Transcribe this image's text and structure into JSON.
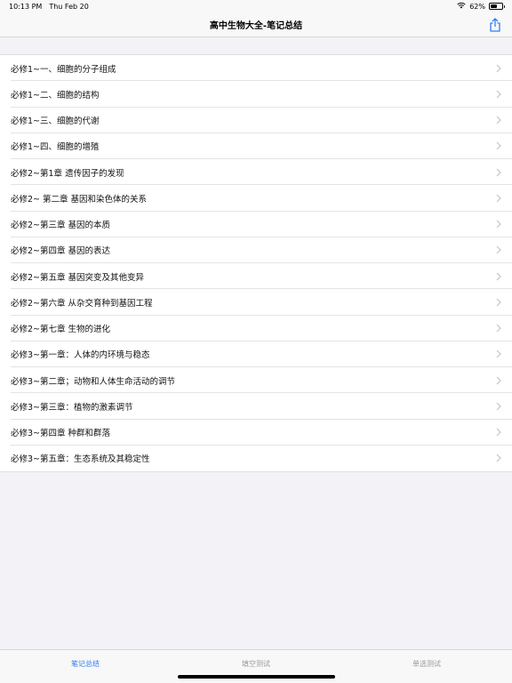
{
  "status": {
    "time": "10:13 PM",
    "date": "Thu Feb 20",
    "battery_percent": "62%",
    "battery_level": 0.62
  },
  "nav": {
    "title": "高中生物大全-笔记总结",
    "share_icon": "share-icon"
  },
  "list": {
    "items": [
      {
        "label": "必修1~一、细胞的分子组成"
      },
      {
        "label": "必修1~二、细胞的结构"
      },
      {
        "label": "必修1~三、细胞的代谢"
      },
      {
        "label": "必修1~四、细胞的增殖"
      },
      {
        "label": "必修2~第1章 遗传因子的发现"
      },
      {
        "label": "必修2~ 第二章 基因和染色体的关系"
      },
      {
        "label": "必修2~第三章 基因的本质"
      },
      {
        "label": "必修2~第四章 基因的表达"
      },
      {
        "label": "必修2~第五章 基因突变及其他变异"
      },
      {
        "label": "必修2~第六章 从杂交育种到基因工程"
      },
      {
        "label": "必修2~第七章 生物的进化"
      },
      {
        "label": "必修3~第一章：人体的内环境与稳态"
      },
      {
        "label": "必修3~第二章；动物和人体生命活动的调节"
      },
      {
        "label": "必修3~第三章：植物的激素调节"
      },
      {
        "label": "必修3~第四章  种群和群落"
      },
      {
        "label": "必修3~第五章：生态系统及其稳定性"
      }
    ]
  },
  "tabs": [
    {
      "label": "笔记总结",
      "active": true
    },
    {
      "label": "填空测试",
      "active": false
    },
    {
      "label": "单选测试",
      "active": false
    }
  ],
  "colors": {
    "accent": "#2f7cf6",
    "inactive_tab": "#999999"
  }
}
